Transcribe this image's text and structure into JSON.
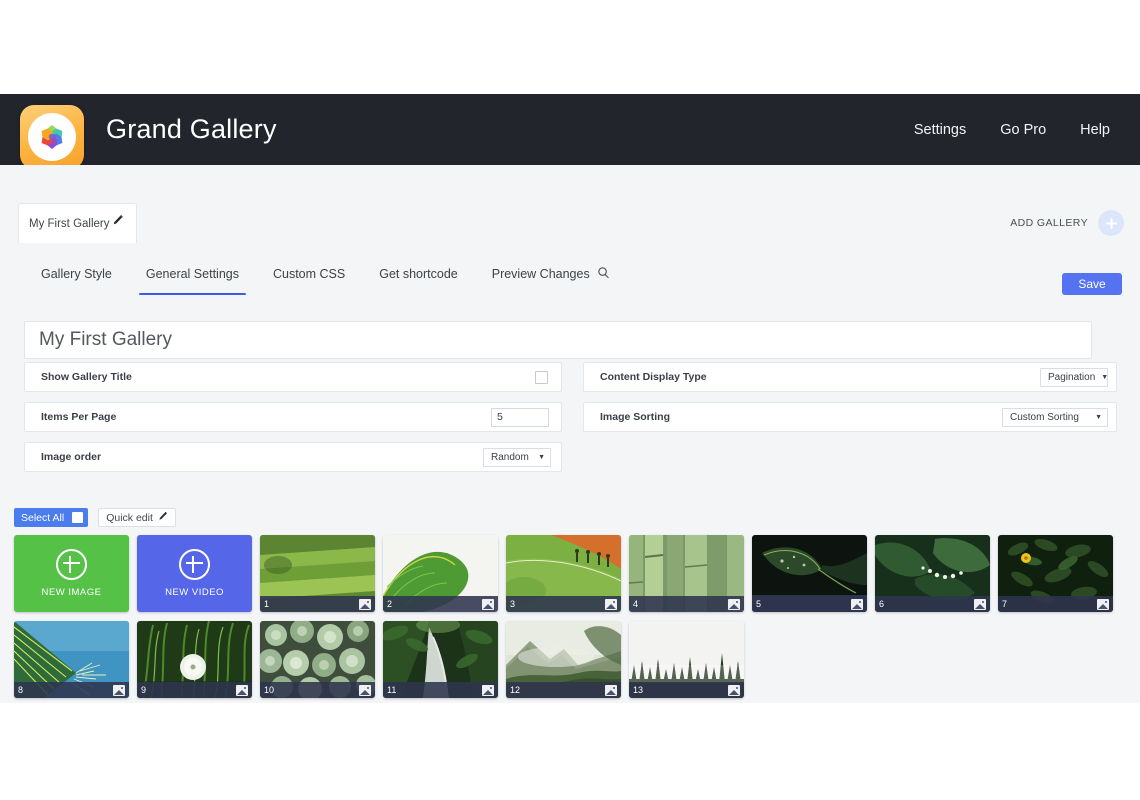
{
  "header": {
    "app_title": "Grand Gallery",
    "logo_icon": "gallery-flower-logo",
    "nav": [
      {
        "label": "Settings"
      },
      {
        "label": "Go Pro"
      },
      {
        "label": "Help"
      }
    ],
    "background_color": "#22252b"
  },
  "gallery_tabs": {
    "active_tab_label": "My First Gallery",
    "edit_icon": "pencil-icon",
    "add_gallery_label": "ADD GALLERY",
    "add_icon": "plus-icon"
  },
  "settings_nav": {
    "items": [
      {
        "label": "Gallery Style",
        "active": false,
        "icon": ""
      },
      {
        "label": "General Settings",
        "active": true,
        "icon": ""
      },
      {
        "label": "Custom CSS",
        "active": false,
        "icon": ""
      },
      {
        "label": "Get shortcode",
        "active": false,
        "icon": ""
      },
      {
        "label": "Preview Changes",
        "active": false,
        "icon": "magnifier-icon"
      }
    ],
    "active_underline_color": "#3c5ce8",
    "save_label": "Save",
    "save_color": "#5572f1"
  },
  "settings_form": {
    "gallery_title_value": "My First Gallery",
    "gallery_title_placeholder": "Gallery title",
    "rows": {
      "show_gallery_title": {
        "label": "Show Gallery Title",
        "checked": false
      },
      "items_per_page": {
        "label": "Items Per Page",
        "value": "5"
      },
      "image_order": {
        "label": "Image order",
        "value": "Random"
      },
      "content_display_type": {
        "label": "Content Display Type",
        "value": "Pagination"
      },
      "image_sorting": {
        "label": "Image Sorting",
        "value": "Custom Sorting"
      }
    }
  },
  "grid_toolbar": {
    "select_all_label": "Select All",
    "select_all_checked": false,
    "quick_edit_label": "Quick edit",
    "quick_edit_icon": "pencil-icon"
  },
  "thumb_grid": {
    "new_image_label": "NEW IMAGE",
    "new_image_color": "#55c247",
    "new_video_label": "NEW VIDEO",
    "new_video_color": "#5566e8",
    "item_icon": "image-icon",
    "items": [
      {
        "number": "1",
        "alt": "green terraced rice fields"
      },
      {
        "number": "2",
        "alt": "large green leaf on white background"
      },
      {
        "number": "3",
        "alt": "green field with orange soil and figures"
      },
      {
        "number": "4",
        "alt": "bamboo stalks close up"
      },
      {
        "number": "5",
        "alt": "dark green leaf with water drops"
      },
      {
        "number": "6",
        "alt": "green leaves with white berries"
      },
      {
        "number": "7",
        "alt": "dark foliage with yellow flower"
      },
      {
        "number": "8",
        "alt": "palm frond against blue sky"
      },
      {
        "number": "9",
        "alt": "dandelion in green grass"
      },
      {
        "number": "10",
        "alt": "succulent plants cluster"
      },
      {
        "number": "11",
        "alt": "path through lush jungle"
      },
      {
        "number": "12",
        "alt": "misty mountain and forest"
      },
      {
        "number": "13",
        "alt": "foggy pine treeline"
      }
    ]
  }
}
